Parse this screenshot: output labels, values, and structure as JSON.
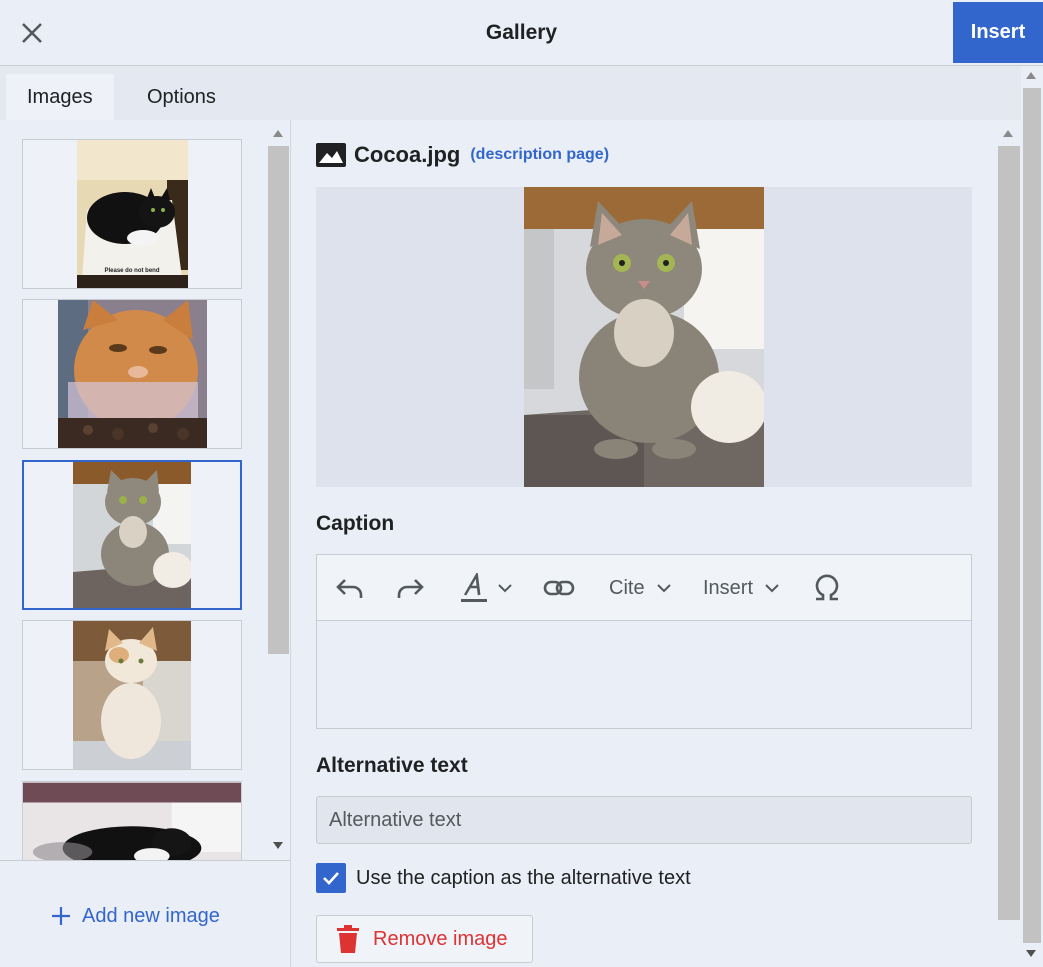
{
  "header": {
    "title": "Gallery",
    "insert_label": "Insert"
  },
  "tabs": [
    {
      "label": "Images",
      "active": true
    },
    {
      "label": "Options",
      "active": false
    }
  ],
  "left_panel": {
    "thumbnails": [
      {
        "subject": "black and white cat on cardboard",
        "caption_text": "Please do not bend",
        "selected": false
      },
      {
        "subject": "orange tabby cat behind plastic",
        "selected": false
      },
      {
        "subject": "grey tabby cat sitting on cat tree",
        "selected": true
      },
      {
        "subject": "cream and ginger cat sitting",
        "selected": false
      },
      {
        "subject": "black and white cat lying",
        "selected": false
      }
    ],
    "add_label": "Add new image"
  },
  "details": {
    "file_name": "Cocoa.jpg",
    "description_link": "(description page)",
    "caption_heading": "Caption",
    "toolbar": {
      "cite_label": "Cite",
      "insert_label": "Insert"
    },
    "alt_heading": "Alternative text",
    "alt_placeholder": "Alternative text",
    "alt_value": "",
    "use_caption_label": "Use the caption as the alternative text",
    "use_caption_checked": true,
    "remove_label": "Remove image"
  },
  "colors": {
    "accent": "#3366cc",
    "destructive": "#d33333",
    "background": "#eaeef6"
  }
}
